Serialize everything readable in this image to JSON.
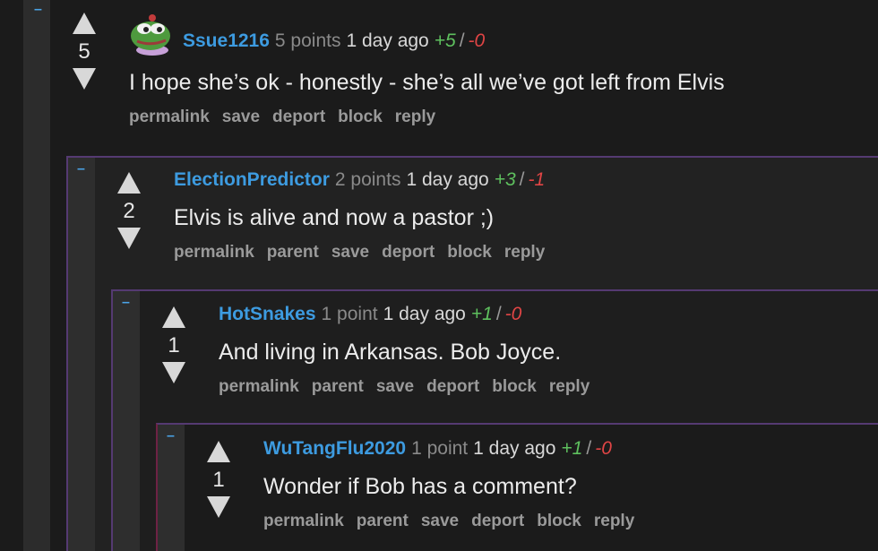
{
  "comments": [
    {
      "user": "Ssue1216",
      "points": "5 points",
      "time": "1 day ago",
      "up": "+5",
      "slash": "/",
      "down": "-0",
      "score": "5",
      "text": "I hope she’s ok - honestly - she’s all we’ve got left from Elvis",
      "links": [
        "permalink",
        "save",
        "deport",
        "block",
        "reply"
      ]
    },
    {
      "user": "ElectionPredictor",
      "points": "2 points",
      "time": "1 day ago",
      "up": "+3",
      "slash": "/",
      "down": "-1",
      "score": "2",
      "text": "Elvis is alive and now a pastor ;)",
      "links": [
        "permalink",
        "parent",
        "save",
        "deport",
        "block",
        "reply"
      ]
    },
    {
      "user": "HotSnakes",
      "points": "1 point",
      "time": "1 day ago",
      "up": "+1",
      "slash": "/",
      "down": "-0",
      "score": "1",
      "text": "And living in Arkansas. Bob Joyce.",
      "links": [
        "permalink",
        "parent",
        "save",
        "deport",
        "block",
        "reply"
      ]
    },
    {
      "user": "WuTangFlu2020",
      "points": "1 point",
      "time": "1 day ago",
      "up": "+1",
      "slash": "/",
      "down": "-0",
      "score": "1",
      "text": "Wonder if Bob has a comment?",
      "links": [
        "permalink",
        "parent",
        "save",
        "deport",
        "block",
        "reply"
      ]
    }
  ],
  "collapse_glyph": "–",
  "colors": {
    "username": "#3d9be0",
    "upvotes": "#5ec05e",
    "downvotes": "#e04545",
    "nest_border": "#553a72"
  },
  "icons": {
    "avatar": "pepe-frog-avatar-icon",
    "upvote": "upvote-arrow-icon",
    "downvote": "downvote-arrow-icon"
  }
}
